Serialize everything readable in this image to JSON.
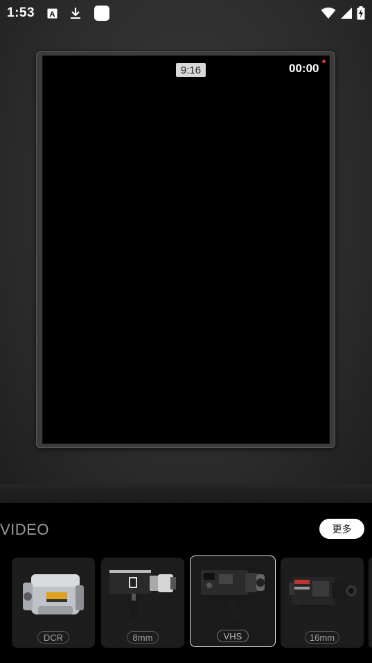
{
  "status_bar": {
    "time": "1:53",
    "notification_icons": [
      "font-a-icon",
      "download-icon",
      "app-square-icon"
    ],
    "system_icons": [
      "wifi-icon",
      "signal-icon",
      "battery-charging-icon"
    ]
  },
  "viewfinder": {
    "aspect_ratio": "9:16",
    "timer": "00:00",
    "recording_indicator_color": "#e53030"
  },
  "camera_picker": {
    "section_title": "VIDEO",
    "more_label": "更多",
    "cameras": [
      {
        "label": "DCR",
        "selected": false
      },
      {
        "label": "8mm",
        "selected": false
      },
      {
        "label": "VHS",
        "selected": true
      },
      {
        "label": "16mm",
        "selected": false
      }
    ]
  }
}
